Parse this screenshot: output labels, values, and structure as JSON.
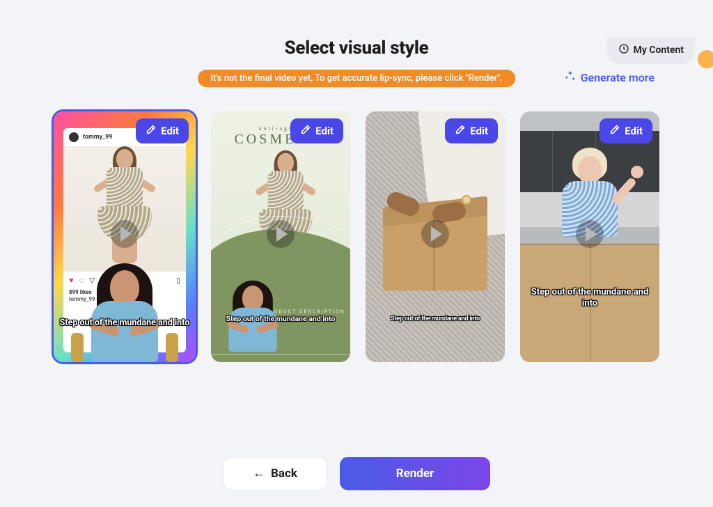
{
  "header": {
    "my_content_label": "My Content",
    "title": "Select visual style",
    "notice": "It's not the final video yet, To get accurate lip-sync, please click \"Render\".",
    "generate_more_label": "Generate more"
  },
  "cards": [
    {
      "edit_label": "Edit",
      "profile_username": "tommy_99",
      "likes_line": "899 likes",
      "likes_user": "tommy_99",
      "caption": "Step out of the mundane and into",
      "selected": true
    },
    {
      "edit_label": "Edit",
      "subheading": "anti-aging",
      "heading": "COSMETIC",
      "desc_label": "PRODUCT DESCRIPTION",
      "caption": "Step out of the mundane and into",
      "selected": false
    },
    {
      "edit_label": "Edit",
      "caption": "Step out of the mundane and into",
      "selected": false
    },
    {
      "edit_label": "Edit",
      "caption": "Step out of the mundane and into",
      "selected": false
    }
  ],
  "actions": {
    "back_label": "Back",
    "render_label": "Render"
  },
  "colors": {
    "accent": "#4a5be6",
    "notice_bg": "#f28b25",
    "edit_bg": "#4a46e8"
  }
}
